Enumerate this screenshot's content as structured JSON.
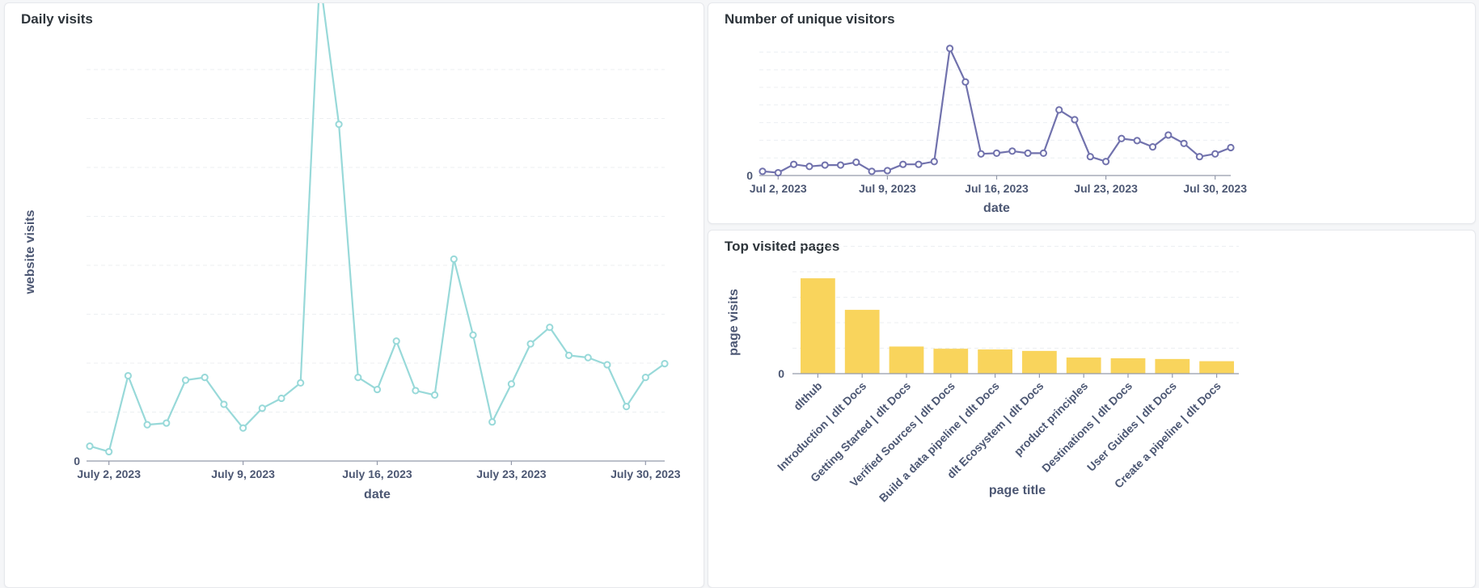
{
  "charts": {
    "daily": {
      "title": "Daily visits",
      "chart_data": {
        "type": "line",
        "ylabel": "website visits",
        "xlabel": "date",
        "y_ticks": [
          "0"
        ],
        "ylim": [
          0,
          760
        ],
        "x_tick_labels": [
          "July 2, 2023",
          "July 9, 2023",
          "July 16, 2023",
          "July 23, 2023",
          "July 30, 2023"
        ],
        "x_tick_days": [
          2,
          9,
          16,
          23,
          30
        ],
        "x_days": [
          1,
          2,
          3,
          4,
          5,
          6,
          7,
          8,
          9,
          10,
          11,
          12,
          13,
          14,
          15,
          16,
          17,
          18,
          19,
          20,
          21,
          22,
          23,
          24,
          25,
          26,
          27,
          28,
          29,
          30,
          31
        ],
        "values": [
          27,
          17,
          155,
          66,
          69,
          147,
          152,
          103,
          60,
          96,
          114,
          142,
          878,
          612,
          152,
          130,
          218,
          128,
          120,
          367,
          229,
          71,
          140,
          213,
          243,
          192,
          188,
          175,
          99,
          152,
          177
        ],
        "color": "#98d9d9",
        "grid": true
      }
    },
    "unique": {
      "title": "Number of unique visitors",
      "chart_data": {
        "type": "line",
        "xlabel": "date",
        "ylabel": "",
        "y_ticks": [
          "0"
        ],
        "ylim": [
          0,
          190
        ],
        "x_tick_labels": [
          "Jul 2, 2023",
          "Jul 9, 2023",
          "Jul 16, 2023",
          "Jul 23, 2023",
          "Jul 30, 2023"
        ],
        "x_tick_days": [
          2,
          9,
          16,
          23,
          30
        ],
        "x_days": [
          1,
          2,
          3,
          4,
          5,
          6,
          7,
          8,
          9,
          10,
          11,
          12,
          13,
          14,
          15,
          16,
          17,
          18,
          19,
          20,
          21,
          22,
          23,
          24,
          25,
          26,
          27,
          28,
          29,
          30,
          31
        ],
        "values": [
          6,
          4,
          16,
          13,
          15,
          15,
          19,
          6,
          7,
          16,
          16,
          20,
          182,
          134,
          31,
          32,
          35,
          32,
          32,
          94,
          80,
          27,
          20,
          53,
          50,
          41,
          58,
          46,
          27,
          31,
          40
        ],
        "color": "#7172ad",
        "grid": true
      }
    },
    "pages": {
      "title": "Top visited pages",
      "chart_data": {
        "type": "bar",
        "xlabel": "page title",
        "ylabel": "page visits",
        "y_ticks": [
          "0"
        ],
        "ylim": [
          0,
          140
        ],
        "categories": [
          "dlthub",
          "Introduction | dlt Docs",
          "Getting Started | dlt Docs",
          "Verified Sources | dlt Docs",
          "Build a data pipeline | dlt Docs",
          "dlt Ecosystem | dlt Docs",
          "product principles",
          "Destinations | dlt Docs",
          "User Guides | dlt Docs",
          "Create a pipeline | dlt Docs"
        ],
        "values": [
          130,
          87,
          37,
          34,
          33,
          31,
          22,
          21,
          20,
          17
        ],
        "color": "#f9d45c",
        "grid": true
      }
    }
  }
}
